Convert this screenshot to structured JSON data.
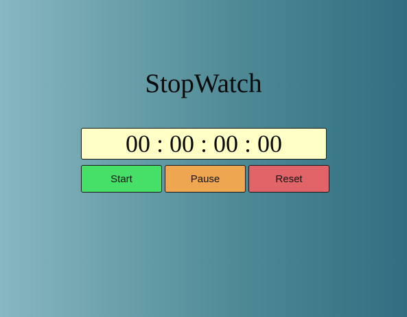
{
  "app": {
    "title": "StopWatch"
  },
  "display": {
    "time": "00 : 00 : 00 : 00"
  },
  "controls": {
    "start_label": "Start",
    "pause_label": "Pause",
    "reset_label": "Reset"
  },
  "colors": {
    "start": "#46e068",
    "pause": "#eea650",
    "reset": "#e06468",
    "display_bg": "#ffffc6"
  }
}
